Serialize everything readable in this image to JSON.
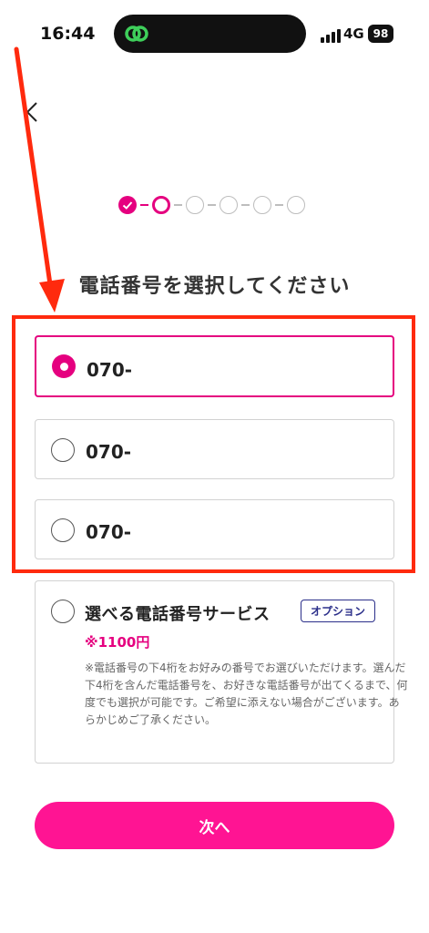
{
  "status_bar": {
    "time": "16:44",
    "network": "4G",
    "battery": "98"
  },
  "page": {
    "title": "電話番号を選択してください"
  },
  "steps": {
    "total": 6,
    "completed": 1,
    "current": 2
  },
  "options": [
    {
      "number": "070-",
      "selected": true
    },
    {
      "number": "070-",
      "selected": false
    },
    {
      "number": "070-",
      "selected": false
    }
  ],
  "service": {
    "title": "選べる電話番号サービス",
    "badge": "オプション",
    "price": "※1100円",
    "note": "※電話番号の下4桁をお好みの番号でお選びいただけます。選んだ下4桁を含んだ電話番号を、お好きな電話番号が出てくるまで、何度でも選択が可能です。ご希望に添えない場合がございます。あらかじめご了承ください。"
  },
  "next_button": {
    "label": "次へ"
  },
  "colors": {
    "accent": "#e5007f",
    "button": "#ff1493",
    "annotation": "#ff2a0e",
    "badge": "#2b2f8a"
  },
  "icons": {
    "back": "chevron-left-icon",
    "app": "link-app-icon"
  }
}
